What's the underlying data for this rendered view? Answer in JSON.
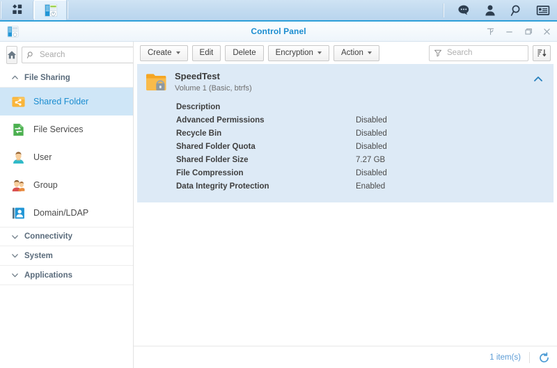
{
  "taskbar": {
    "apps_launcher": {
      "name": "apps-launcher",
      "label": "Main Menu"
    },
    "open_app": {
      "name": "control-panel-task",
      "label": "Control Panel"
    },
    "tray": [
      {
        "icon": "notifications-icon",
        "label": "Notifications"
      },
      {
        "icon": "user-icon",
        "label": "Options"
      },
      {
        "icon": "search-icon",
        "label": "Search"
      },
      {
        "icon": "widgets-icon",
        "label": "Widgets"
      }
    ]
  },
  "window": {
    "title": "Control Panel",
    "icon": "control-panel-icon",
    "controls": [
      {
        "icon": "pin-icon",
        "label": "Pin"
      },
      {
        "icon": "minimize-icon",
        "label": "Minimize"
      },
      {
        "icon": "maximize-icon",
        "label": "Maximize"
      },
      {
        "icon": "close-icon",
        "label": "Close"
      }
    ]
  },
  "sidebar": {
    "home_label": "Home",
    "search_placeholder": "Search",
    "search_value": "",
    "groups": [
      {
        "label": "File Sharing",
        "expanded": true,
        "items": [
          {
            "label": "Shared Folder",
            "icon": "shared-folder-icon",
            "selected": true
          },
          {
            "label": "File Services",
            "icon": "file-services-icon",
            "selected": false
          },
          {
            "label": "User",
            "icon": "user-icon",
            "selected": false
          },
          {
            "label": "Group",
            "icon": "group-icon",
            "selected": false
          },
          {
            "label": "Domain/LDAP",
            "icon": "domain-ldap-icon",
            "selected": false
          }
        ]
      },
      {
        "label": "Connectivity",
        "expanded": false,
        "items": []
      },
      {
        "label": "System",
        "expanded": false,
        "items": []
      },
      {
        "label": "Applications",
        "expanded": false,
        "items": []
      }
    ]
  },
  "toolbar": {
    "buttons": [
      {
        "label": "Create",
        "has_caret": true
      },
      {
        "label": "Edit",
        "has_caret": false
      },
      {
        "label": "Delete",
        "has_caret": false
      },
      {
        "label": "Encryption",
        "has_caret": true
      },
      {
        "label": "Action",
        "has_caret": true
      }
    ],
    "search_placeholder": "Search",
    "search_value": "",
    "sort_icon": "sort-descending-icon"
  },
  "folder": {
    "name": "SpeedTest",
    "location": "Volume 1 (Basic, btrfs)",
    "icon": "encrypted-folder-icon",
    "collapse_icon": "chevron-up-icon",
    "details": [
      {
        "label": "Description",
        "value": ""
      },
      {
        "label": "Advanced Permissions",
        "value": "Disabled"
      },
      {
        "label": "Recycle Bin",
        "value": "Disabled"
      },
      {
        "label": "Shared Folder Quota",
        "value": "Disabled"
      },
      {
        "label": "Shared Folder Size",
        "value": "7.27 GB"
      },
      {
        "label": "File Compression",
        "value": "Disabled"
      },
      {
        "label": "Data Integrity Protection",
        "value": "Enabled"
      }
    ]
  },
  "footer": {
    "item_count": "1 item(s)",
    "refresh_icon": "refresh-icon"
  },
  "colors": {
    "accent": "#1b8dd0",
    "taskbar": "#c3dbf0",
    "selection": "#cfe6f7",
    "card_bg": "#ddeaf6",
    "folder_orange": "#f5a623"
  }
}
